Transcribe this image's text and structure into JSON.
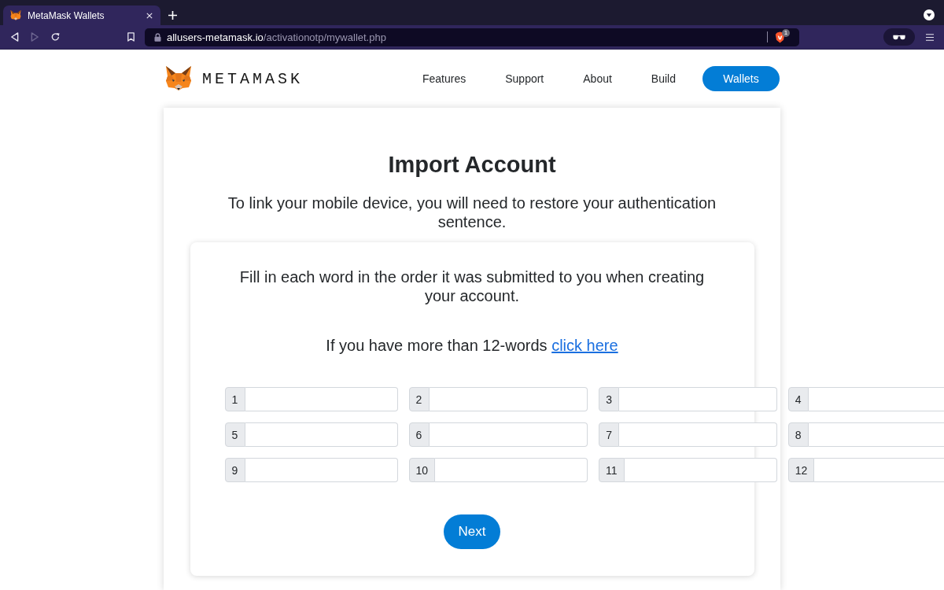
{
  "browser": {
    "tabs": [
      {
        "title": "MetaMask Wallets",
        "selected": true
      }
    ],
    "nav_buttons": [
      {
        "kind": "back",
        "disabled": false
      },
      {
        "kind": "forward",
        "disabled": true
      },
      {
        "kind": "reload",
        "disabled": false
      }
    ],
    "address_bar": {
      "domain": "allusers-metamask.io",
      "path": "/activationotp/mywallet.php"
    },
    "shields_badge": "1"
  },
  "header": {
    "logo_text": "METAMASK",
    "nav": [
      {
        "label": "Features",
        "kind": "link"
      },
      {
        "label": "Support",
        "kind": "link"
      },
      {
        "label": "About",
        "kind": "link"
      },
      {
        "label": "Build",
        "kind": "link"
      },
      {
        "label": "Wallets",
        "kind": "button"
      }
    ]
  },
  "import_form": {
    "title": "Import Account",
    "subtitle": "To link your mobile device, you will need to restore your authentication sentence.",
    "instructions": "Fill in each word in the order it was submitted to you when creating your account.",
    "more_words_text": "If you have more than 12-words",
    "more_words_link": "click here",
    "word_fields": [
      {
        "number": "1"
      },
      {
        "number": "2"
      },
      {
        "number": "3"
      },
      {
        "number": "4"
      },
      {
        "number": "5"
      },
      {
        "number": "6"
      },
      {
        "number": "7"
      },
      {
        "number": "8"
      },
      {
        "number": "9"
      },
      {
        "number": "10"
      },
      {
        "number": "11"
      },
      {
        "number": "12"
      }
    ],
    "next_button": "Next"
  }
}
